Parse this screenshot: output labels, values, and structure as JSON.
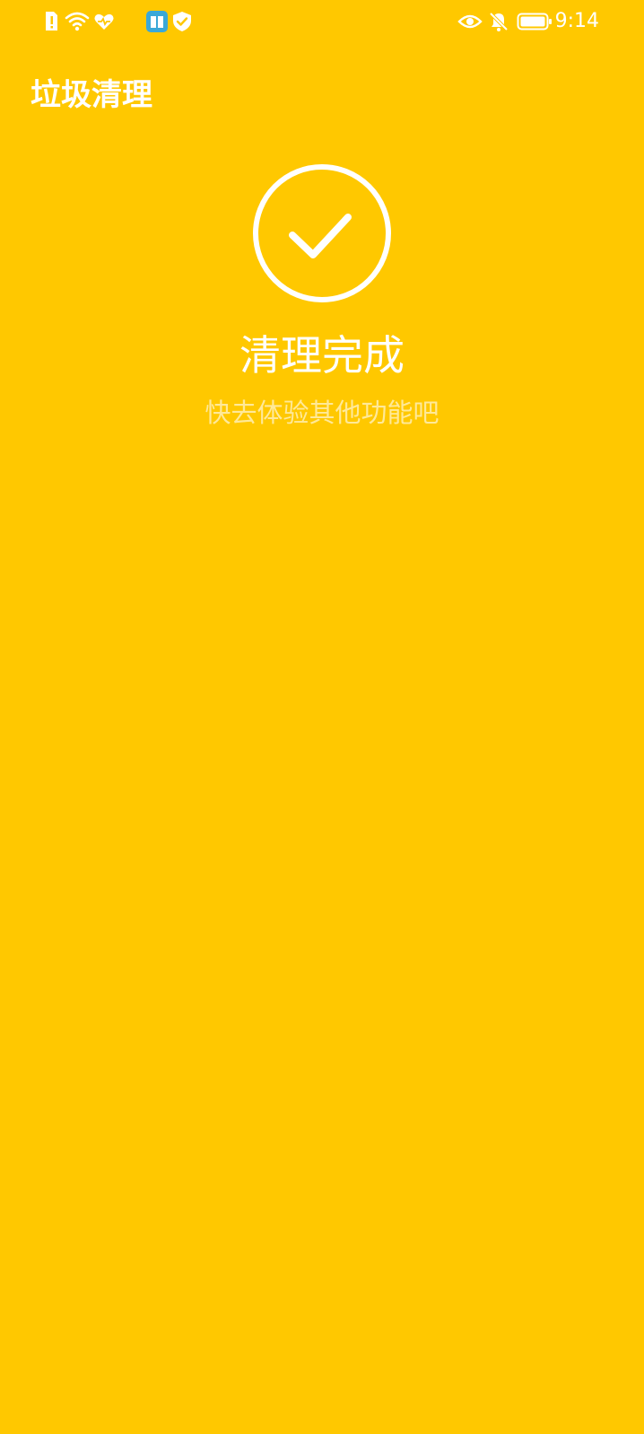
{
  "status_bar": {
    "time": "9:14",
    "left_icons": [
      "sim-alert-icon",
      "wifi-icon",
      "health-heart-icon",
      "book-app-icon",
      "shield-check-icon"
    ],
    "right_icons": [
      "eye-comfort-icon",
      "mute-bell-icon",
      "battery-icon"
    ]
  },
  "app_bar": {
    "title": "垃圾清理"
  },
  "result": {
    "title": "清理完成",
    "subtitle": "快去体验其他功能吧",
    "icon": "check-circle-icon"
  },
  "colors": {
    "background": "#FFC800",
    "foreground": "#FFFFFF",
    "subtitle": "rgba(255,255,255,0.6)",
    "book_app_accent": "#3AA8D8"
  }
}
